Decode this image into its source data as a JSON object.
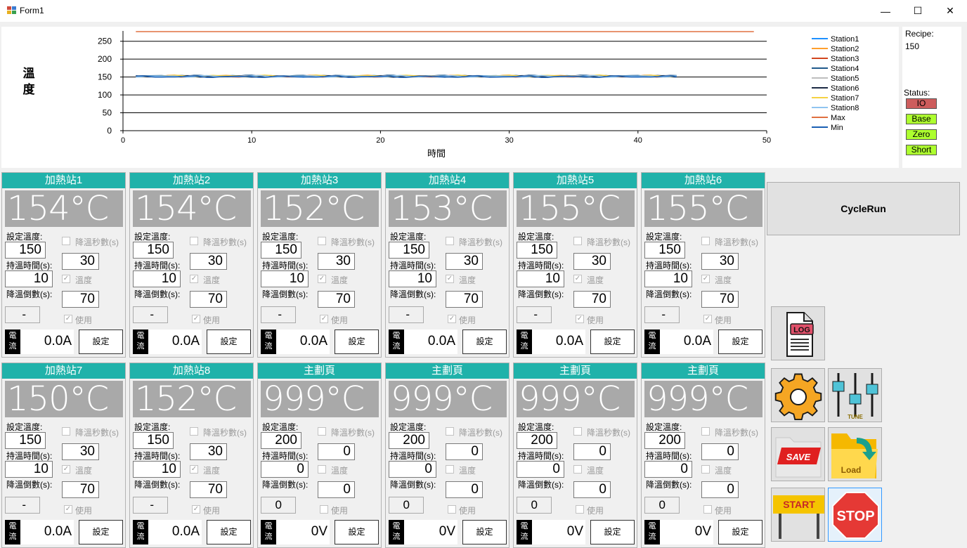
{
  "window": {
    "title": "Form1",
    "minimize": "—",
    "maximize": "☐",
    "close": "✕"
  },
  "chart_data": {
    "type": "line",
    "ylabel": "溫度",
    "xlabel": "時間",
    "xlim": [
      0,
      50
    ],
    "ylim": [
      0,
      275
    ],
    "x_ticks": [
      "0",
      "10",
      "20",
      "30",
      "40",
      "50"
    ],
    "y_ticks": [
      "0",
      "50",
      "100",
      "150",
      "200",
      "250"
    ],
    "legend_position": "right",
    "series": [
      {
        "name": "Station1",
        "color": "#1e90ff",
        "x_range": [
          1,
          43
        ],
        "mean": 152
      },
      {
        "name": "Station2",
        "color": "#ff9f2e",
        "x_range": [
          1,
          43
        ],
        "mean": 153
      },
      {
        "name": "Station3",
        "color": "#d2461e",
        "x_range": [
          1,
          43
        ],
        "mean": 152
      },
      {
        "name": "Station4",
        "color": "#205a8c",
        "x_range": [
          1,
          43
        ],
        "mean": 153
      },
      {
        "name": "Station5",
        "color": "#bdbdbd",
        "x_range": [
          1,
          43
        ],
        "mean": 152
      },
      {
        "name": "Station6",
        "color": "#1c2a44",
        "x_range": [
          1,
          43
        ],
        "mean": 152
      },
      {
        "name": "Station7",
        "color": "#f5d142",
        "x_range": [
          1,
          43
        ],
        "mean": 153
      },
      {
        "name": "Station8",
        "color": "#8fc4f0",
        "x_range": [
          1,
          43
        ],
        "mean": 152
      },
      {
        "name": "Max",
        "color": "#e07040",
        "x_range": [
          1,
          49
        ],
        "mean": 277
      },
      {
        "name": "Min",
        "color": "#1a5fb4",
        "x_range": [
          1,
          43
        ],
        "mean": 151
      }
    ]
  },
  "recipe": {
    "label": "Recipe:",
    "value": "150"
  },
  "status": {
    "label": "Status:",
    "indicators": [
      {
        "label": "IO",
        "color": "#cd5c5c"
      },
      {
        "label": "Base",
        "color": "#adff2f"
      },
      {
        "label": "Zero",
        "color": "#adff2f"
      },
      {
        "label": "Short",
        "color": "#adff2f"
      }
    ]
  },
  "labels": {
    "set_temp": "設定溫度:",
    "hold_time": "持溫時間(s):",
    "cool_count": "降溫倒數(s):",
    "cool_sec": "降溫秒數(s)",
    "temp": "溫度",
    "use": "使用",
    "current_badge_1": "電",
    "current_badge_2": "流",
    "set_button": "設定"
  },
  "stations": [
    {
      "title": "加熱站1",
      "temp": "154°C",
      "set_temp": "150",
      "hold_time": "10",
      "cool_sec": "30",
      "cool_count": "70",
      "countdown": "-",
      "reading": "0.0A",
      "temp_checked": true,
      "use_checked": true
    },
    {
      "title": "加熱站2",
      "temp": "154°C",
      "set_temp": "150",
      "hold_time": "10",
      "cool_sec": "30",
      "cool_count": "70",
      "countdown": "-",
      "reading": "0.0A",
      "temp_checked": true,
      "use_checked": true
    },
    {
      "title": "加熱站3",
      "temp": "152°C",
      "set_temp": "150",
      "hold_time": "10",
      "cool_sec": "30",
      "cool_count": "70",
      "countdown": "-",
      "reading": "0.0A",
      "temp_checked": true,
      "use_checked": true
    },
    {
      "title": "加熱站4",
      "temp": "153°C",
      "set_temp": "150",
      "hold_time": "10",
      "cool_sec": "30",
      "cool_count": "70",
      "countdown": "-",
      "reading": "0.0A",
      "temp_checked": true,
      "use_checked": true
    },
    {
      "title": "加熱站5",
      "temp": "155°C",
      "set_temp": "150",
      "hold_time": "10",
      "cool_sec": "30",
      "cool_count": "70",
      "countdown": "-",
      "reading": "0.0A",
      "temp_checked": true,
      "use_checked": true
    },
    {
      "title": "加熱站6",
      "temp": "155°C",
      "set_temp": "150",
      "hold_time": "10",
      "cool_sec": "30",
      "cool_count": "70",
      "countdown": "-",
      "reading": "0.0A",
      "temp_checked": true,
      "use_checked": true
    },
    {
      "title": "加熱站7",
      "temp": "150°C",
      "set_temp": "150",
      "hold_time": "10",
      "cool_sec": "30",
      "cool_count": "70",
      "countdown": "-",
      "reading": "0.0A",
      "temp_checked": true,
      "use_checked": true
    },
    {
      "title": "加熱站8",
      "temp": "152°C",
      "set_temp": "150",
      "hold_time": "10",
      "cool_sec": "30",
      "cool_count": "70",
      "countdown": "-",
      "reading": "0.0A",
      "temp_checked": true,
      "use_checked": true
    },
    {
      "title": "主劃頁",
      "temp": "999°C",
      "set_temp": "200",
      "hold_time": "0",
      "cool_sec": "0",
      "cool_count": "0",
      "countdown": "0",
      "reading": "0V",
      "temp_checked": false,
      "use_checked": false
    },
    {
      "title": "主劃頁",
      "temp": "999°C",
      "set_temp": "200",
      "hold_time": "0",
      "cool_sec": "0",
      "cool_count": "0",
      "countdown": "0",
      "reading": "0V",
      "temp_checked": false,
      "use_checked": false
    },
    {
      "title": "主劃頁",
      "temp": "999°C",
      "set_temp": "200",
      "hold_time": "0",
      "cool_sec": "0",
      "cool_count": "0",
      "countdown": "0",
      "reading": "0V",
      "temp_checked": false,
      "use_checked": false
    },
    {
      "title": "主劃頁",
      "temp": "999°C",
      "set_temp": "200",
      "hold_time": "0",
      "cool_sec": "0",
      "cool_count": "0",
      "countdown": "0",
      "reading": "0V",
      "temp_checked": false,
      "use_checked": false
    }
  ],
  "controls": {
    "cycle_run": "CycleRun",
    "log_icon_text": "LOG",
    "tune_icon_text": "TUNE",
    "save_icon_text": "SAVE",
    "load_icon_text": "Load",
    "start_icon_text": "START",
    "stop_icon_text": "STOP"
  }
}
